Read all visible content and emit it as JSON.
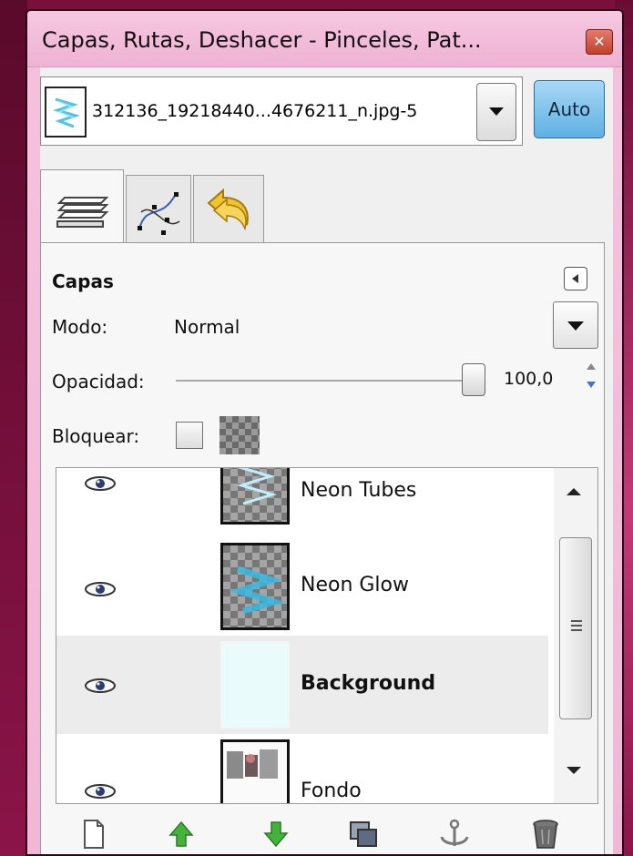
{
  "window": {
    "title": "Capas, Rutas, Deshacer - Pinceles, Pat...",
    "close_glyph": "✕"
  },
  "image_selector": {
    "name": "312136_19218440...4676211_n.jpg-5",
    "auto_label": "Auto"
  },
  "tabs": [
    {
      "name": "layers-tab-icon"
    },
    {
      "name": "paths-tab-icon"
    },
    {
      "name": "undo-tab-icon"
    }
  ],
  "panel": {
    "title": "Capas",
    "mode_label": "Modo:",
    "mode_value": "Normal",
    "opacity_label": "Opacidad:",
    "opacity_value": "100,0",
    "lock_label": "Bloquear:"
  },
  "layers": [
    {
      "name": "Neon Tubes",
      "visible": true,
      "selected": false
    },
    {
      "name": "Neon Glow",
      "visible": true,
      "selected": false
    },
    {
      "name": "Background",
      "visible": true,
      "selected": true
    },
    {
      "name": "Fondo",
      "visible": true,
      "selected": false
    }
  ],
  "bottom_buttons": [
    "new-layer-icon",
    "raise-layer-icon",
    "lower-layer-icon",
    "duplicate-layer-icon",
    "anchor-layer-icon",
    "delete-layer-icon"
  ],
  "colors": {
    "titlebar": "#f2bcd9",
    "auto_button": "#7cc2ec",
    "selected_row": "#ececec",
    "raise_arrow": "#3fae3a",
    "background_thumb": "#eafbfb"
  }
}
